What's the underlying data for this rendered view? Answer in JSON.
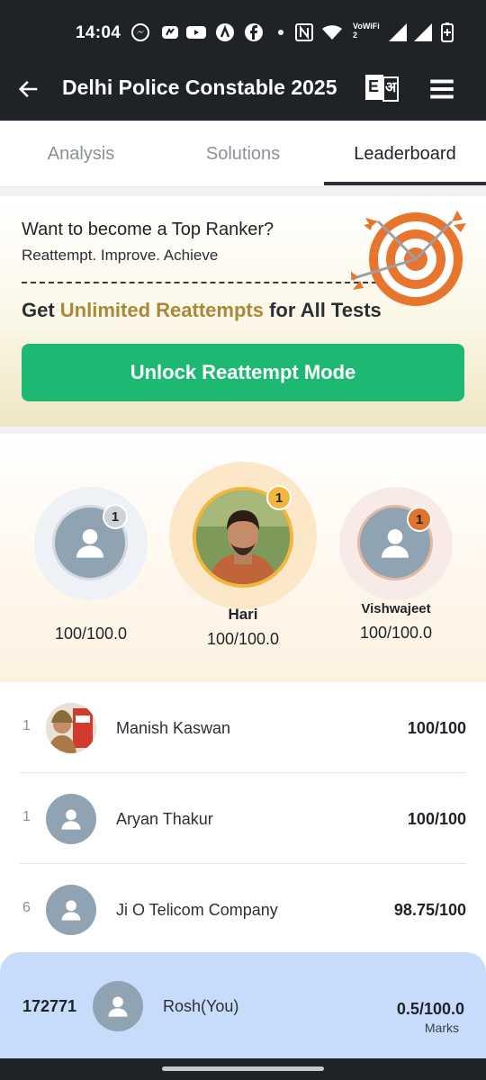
{
  "status_bar": {
    "time": "14:04",
    "icons": [
      "messenger-icon",
      "app-icon",
      "youtube-icon",
      "app-icon",
      "facebook-icon",
      "dot-icon",
      "nfc-icon",
      "wifi-icon",
      "vowifi-icon",
      "signal-icon",
      "signal-icon",
      "battery-icon"
    ],
    "vowifi_label": "VoWiFi 2"
  },
  "app_bar": {
    "title": "Delhi Police Constable 2025",
    "lang_toggle": {
      "left": "E",
      "right": "अ"
    }
  },
  "tabs": [
    {
      "label": "Analysis",
      "active": false
    },
    {
      "label": "Solutions",
      "active": false
    },
    {
      "label": "Leaderboard",
      "active": true
    }
  ],
  "promo": {
    "title": "Want to become a Top Ranker?",
    "subtitle": "Reattempt. Improve. Achieve",
    "headline_prefix": "Get ",
    "headline_highlight": "Unlimited Reattempts",
    "headline_suffix": " for All Tests",
    "button_label": "Unlock Reattempt Mode",
    "accent_color": "#a8893a",
    "button_color": "#1db872"
  },
  "podium": [
    {
      "position": "left",
      "name": "",
      "score": "100/100.0",
      "rank": "1",
      "badge_color": "#cfd3d8",
      "avatar": "default-user-icon"
    },
    {
      "position": "center",
      "name": "Hari",
      "score": "100/100.0",
      "rank": "1",
      "badge_color": "#f2b63c",
      "avatar": "photo"
    },
    {
      "position": "right",
      "name": "Vishwajeet",
      "score": "100/100.0",
      "rank": "1",
      "badge_color": "#e0742f",
      "avatar": "default-user-icon"
    }
  ],
  "leaderboard": [
    {
      "rank": "1",
      "name": "Manish Kaswan",
      "score": "100/100",
      "avatar": "photo"
    },
    {
      "rank": "1",
      "name": "Aryan Thakur",
      "score": "100/100",
      "avatar": "default-user-icon"
    },
    {
      "rank": "6",
      "name": "Ji O Telicom Company",
      "score": "98.75/100",
      "avatar": "default-user-icon"
    }
  ],
  "current_user": {
    "rank": "172771",
    "name": "Rosh(You)",
    "score": "0.5/100.0",
    "score_caption": "Marks"
  }
}
